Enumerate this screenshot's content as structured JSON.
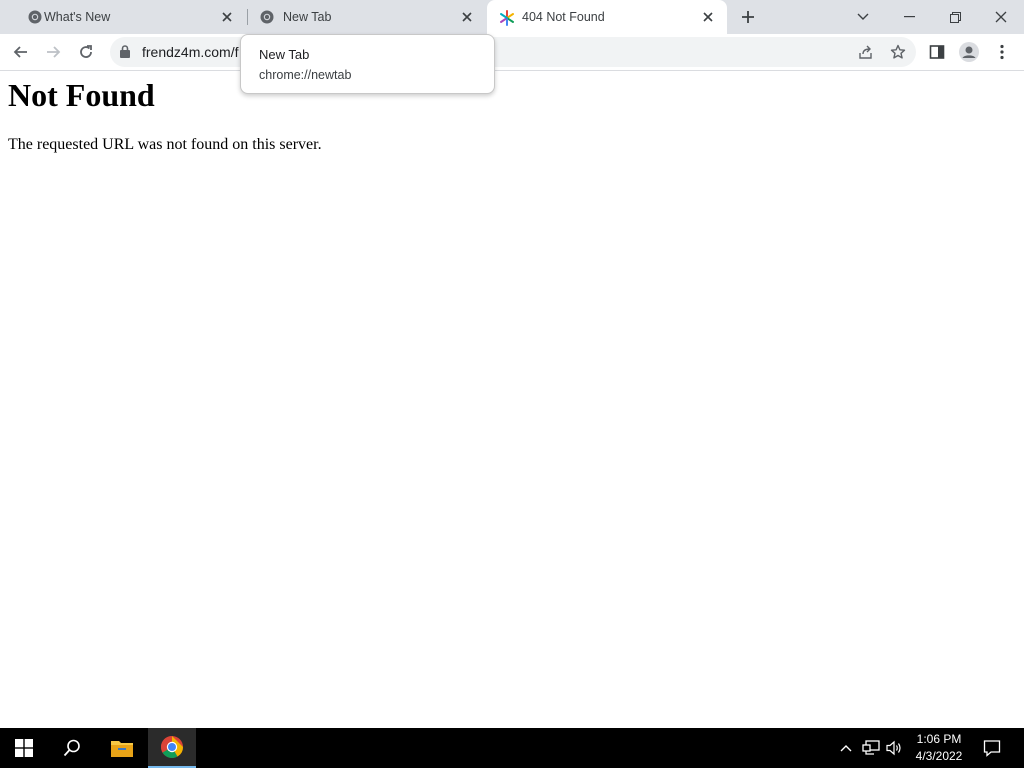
{
  "tabs": [
    {
      "title": "What's New",
      "icon": "chrome-icon",
      "active": false
    },
    {
      "title": "New Tab",
      "icon": "chrome-icon",
      "active": false
    },
    {
      "title": "404 Not Found",
      "icon": "site-favicon",
      "active": true
    }
  ],
  "toolbar": {
    "url": "frendz4m.com/f"
  },
  "tooltip": {
    "title": "New Tab",
    "url": "chrome://newtab"
  },
  "page": {
    "heading": "Not Found",
    "message": "The requested URL was not found on this server."
  },
  "taskbar": {
    "time": "1:06 PM",
    "date": "4/3/2022"
  },
  "colors": {
    "tabstrip_bg": "#dee1e6",
    "omnibox_bg": "#f1f3f4",
    "taskbar_bg": "#000000"
  }
}
